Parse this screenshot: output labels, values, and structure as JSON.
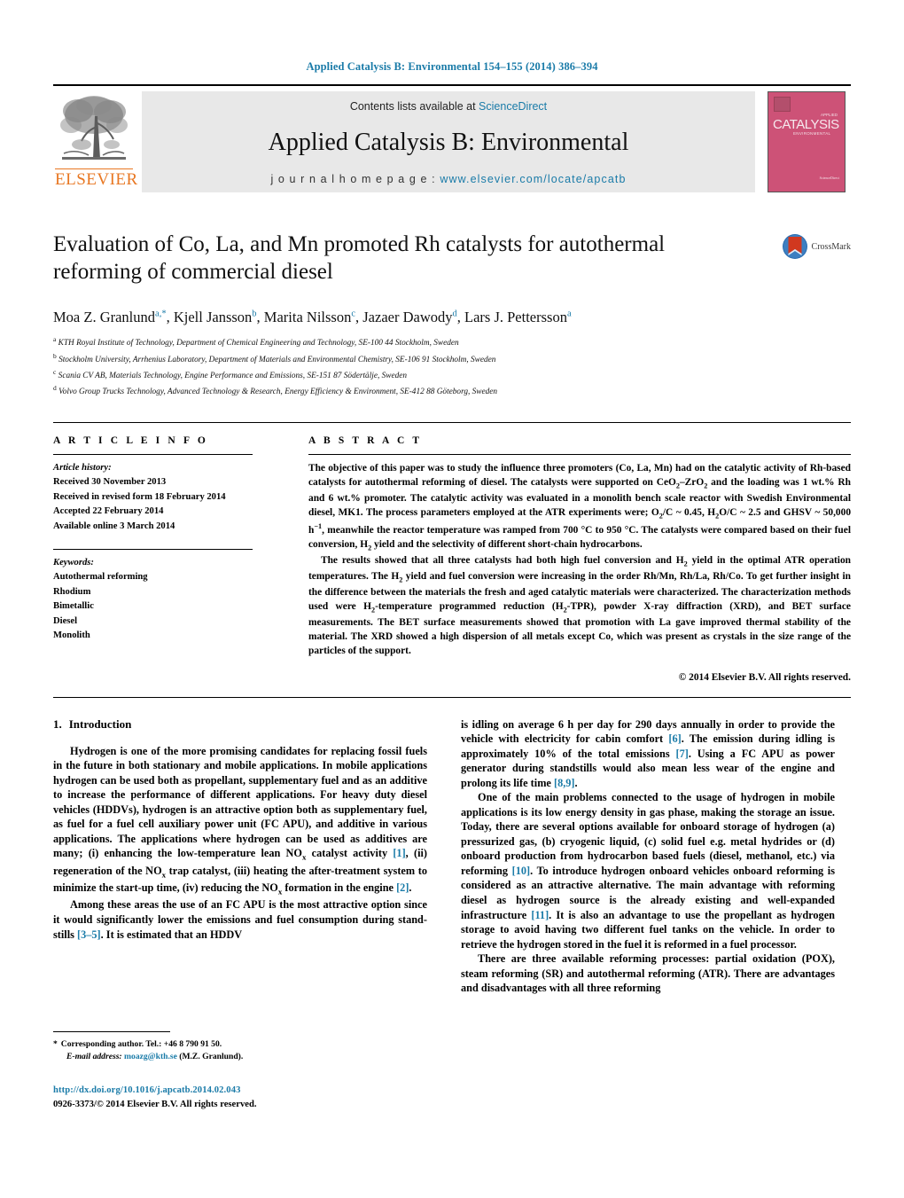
{
  "running_head": "Applied Catalysis B: Environmental 154–155 (2014) 386–394",
  "masthead": {
    "contents_prefix": "Contents lists available at ",
    "sciencedirect": "ScienceDirect",
    "journal_title": "Applied Catalysis B: Environmental",
    "homepage_prefix": "j o u r n a l   h o m e p a g e :  ",
    "homepage_url": "www.elsevier.com/locate/apcatb",
    "publisher": "ELSEVIER",
    "publisher_color": "#E87722",
    "cover": {
      "title": "CATALYSIS",
      "subtitle": "ENVIRONMENTAL",
      "applied": "APPLIED",
      "sciencedirect": "Available online at",
      "sciencedirect_name": "ScienceDirect",
      "color": "#cd5277"
    }
  },
  "title": "Evaluation of Co, La, and Mn promoted Rh catalysts for autothermal reforming of commercial diesel",
  "crossmark": {
    "label": "CrossMark"
  },
  "authors_html": "Moa Z. Granlund<sup>a,*</sup>, Kjell Jansson<sup>b</sup>, Marita Nilsson<sup>c</sup>, Jazaer Dawody<sup>d</sup>, Lars J. Pettersson<sup>a</sup>",
  "affiliations": [
    {
      "mark": "a",
      "text": "KTH Royal Institute of Technology, Department of Chemical Engineering and Technology, SE-100 44 Stockholm, Sweden"
    },
    {
      "mark": "b",
      "text": "Stockholm University, Arrhenius Laboratory, Department of Materials and Environmental Chemistry, SE-106 91 Stockholm, Sweden"
    },
    {
      "mark": "c",
      "text": "Scania CV AB, Materials Technology, Engine Performance and Emissions, SE-151 87 Södertälje, Sweden"
    },
    {
      "mark": "d",
      "text": "Volvo Group Trucks Technology, Advanced Technology & Research, Energy Efficiency & Environment, SE-412 88 Göteborg, Sweden"
    }
  ],
  "article_info": {
    "label": "A R T I C L E   I N F O",
    "history_label": "Article history:",
    "history": [
      "Received 30 November 2013",
      "Received in revised form 18 February 2014",
      "Accepted 22 February 2014",
      "Available online 3 March 2014"
    ],
    "keywords_label": "Keywords:",
    "keywords": [
      "Autothermal reforming",
      "Rhodium",
      "Bimetallic",
      "Diesel",
      "Monolith"
    ]
  },
  "abstract": {
    "label": "A B S T R A C T",
    "paragraph_1_html": "The objective of this paper was to study the influence three promoters (Co, La, Mn) had on the catalytic activity of Rh-based catalysts for autothermal reforming of diesel. The catalysts were supported on CeO<sub>2</sub>–ZrO<sub>2</sub> and the loading was 1 wt.% Rh and 6 wt.% promoter. The catalytic activity was evaluated in a monolith bench scale reactor with Swedish Environmental diesel, MK1. The process parameters employed at the ATR experiments were; O<sub>2</sub>/C ~ 0.45, H<sub>2</sub>O/C ~ 2.5 and GHSV ~ 50,000 h<sup>−1</sup>, meanwhile the reactor temperature was ramped from 700 °C to 950 °C. The catalysts were compared based on their fuel conversion, H<sub>2</sub> yield and the selectivity of different short-chain hydrocarbons.",
    "paragraph_2_html": "The results showed that all three catalysts had both high fuel conversion and H<sub>2</sub> yield in the optimal ATR operation temperatures. The H<sub>2</sub> yield and fuel conversion were increasing in the order Rh/Mn, Rh/La, Rh/Co. To get further insight in the difference between the materials the fresh and aged catalytic materials were characterized. The characterization methods used were H<sub>2</sub>-temperature programmed reduction (H<sub>2</sub>-TPR), powder X-ray diffraction (XRD), and BET surface measurements. The BET surface measurements showed that promotion with La gave improved thermal stability of the material. The XRD showed a high dispersion of all metals except Co, which was present as crystals in the size range of the particles of the support.",
    "copyright": "© 2014 Elsevier B.V. All rights reserved."
  },
  "sections": {
    "introduction": {
      "number": "1.",
      "title": "Introduction"
    }
  },
  "body": {
    "left_paragraphs_html": [
      "Hydrogen is one of the more promising candidates for replacing fossil fuels in the future in both stationary and mobile applications. In mobile applications hydrogen can be used both as propellant, supplementary fuel and as an additive to increase the performance of different applications. For heavy duty diesel vehicles (HDDVs), hydrogen is an attractive option both as supplementary fuel, as fuel for a fuel cell auxiliary power unit (FC APU), and additive in various applications. The applications where hydrogen can be used as additives are many; (i) enhancing the low-temperature lean NO<sub>x</sub> catalyst activity <span class=\"ref\">[1]</span>, (ii) regeneration of the NO<sub>x</sub> trap catalyst, (iii) heating the after-treatment system to minimize the start-up time, (iv) reducing the NO<sub>x</sub> formation in the engine <span class=\"ref\">[2]</span>.",
      "Among these areas the use of an FC APU is the most attractive option since it would significantly lower the emissions and fuel consumption during stand-stills <span class=\"ref\">[3–5]</span>. It is estimated that an HDDV"
    ],
    "right_paragraphs_html": [
      "is idling on average 6 h per day for 290 days annually in order to provide the vehicle with electricity for cabin comfort <span class=\"ref\">[6]</span>. The emission during idling is approximately 10% of the total emissions <span class=\"ref\">[7]</span>. Using a FC APU as power generator during standstills would also mean less wear of the engine and prolong its life time <span class=\"ref\">[8,9]</span>.",
      "One of the main problems connected to the usage of hydrogen in mobile applications is its low energy density in gas phase, making the storage an issue. Today, there are several options available for onboard storage of hydrogen (a) pressurized gas, (b) cryogenic liquid, (c) solid fuel e.g. metal hydrides or (d) onboard production from hydrocarbon based fuels (diesel, methanol, etc.) via reforming <span class=\"ref\">[10]</span>. To introduce hydrogen onboard vehicles onboard reforming is considered as an attractive alternative. The main advantage with reforming diesel as hydrogen source is the already existing and well-expanded infrastructure <span class=\"ref\">[11]</span>. It is also an advantage to use the propellant as hydrogen storage to avoid having two different fuel tanks on the vehicle. In order to retrieve the hydrogen stored in the fuel it is reformed in a fuel processor.",
      "There are three available reforming processes: partial oxidation (POX), steam reforming (SR) and autothermal reforming (ATR). There are advantages and disadvantages with all three reforming"
    ]
  },
  "footnote": {
    "star": "*",
    "corresponding": "Corresponding author. Tel.: +46 8 790 91 50.",
    "email_label": "E-mail address:",
    "email": "moazg@kth.se",
    "email_suffix": "(M.Z. Granlund)."
  },
  "footer": {
    "doi": "http://dx.doi.org/10.1016/j.apcatb.2014.02.043",
    "issn": "0926-3373/© 2014 Elsevier B.V. All rights reserved."
  },
  "colors": {
    "link": "#1a7ba8",
    "elsevier_orange": "#E87722",
    "cover_pink": "#cd5277"
  }
}
